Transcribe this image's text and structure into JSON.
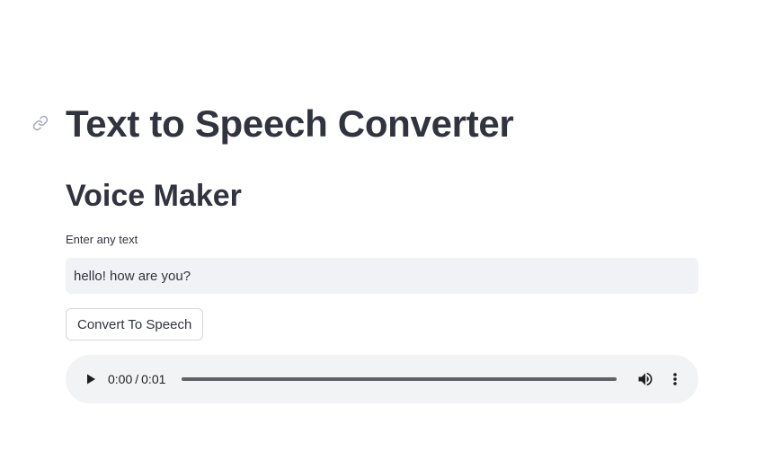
{
  "header": {
    "title": "Text to Speech Converter",
    "link_icon": "link-icon"
  },
  "section": {
    "subtitle": "Voice Maker"
  },
  "text_input": {
    "label": "Enter any text",
    "value": "hello! how are you?"
  },
  "convert_button": {
    "label": "Convert To Speech"
  },
  "audio_player": {
    "current_time": "0:00",
    "duration": "0:01",
    "separator": "/",
    "progress": 0,
    "icons": {
      "play": "play-icon",
      "volume": "volume-icon",
      "menu": "more-vert-icon"
    }
  },
  "colors": {
    "text": "#31333f",
    "input_bg": "#f0f2f6",
    "player_bg": "#f1f3f4",
    "button_border": "#d5d6da"
  }
}
